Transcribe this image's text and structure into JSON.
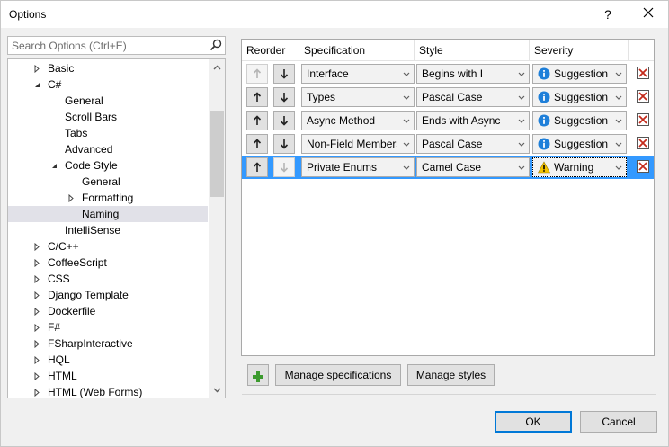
{
  "window": {
    "title": "Options",
    "help_label": "?"
  },
  "search": {
    "placeholder": "Search Options (Ctrl+E)"
  },
  "tree": {
    "items": [
      {
        "label": "Basic",
        "level": 1,
        "arrow": "collapsed"
      },
      {
        "label": "C#",
        "level": 1,
        "arrow": "expanded"
      },
      {
        "label": "General",
        "level": 2,
        "arrow": "none"
      },
      {
        "label": "Scroll Bars",
        "level": 2,
        "arrow": "none"
      },
      {
        "label": "Tabs",
        "level": 2,
        "arrow": "none"
      },
      {
        "label": "Advanced",
        "level": 2,
        "arrow": "none"
      },
      {
        "label": "Code Style",
        "level": 2,
        "arrow": "expanded"
      },
      {
        "label": "General",
        "level": 3,
        "arrow": "none"
      },
      {
        "label": "Formatting",
        "level": 3,
        "arrow": "collapsed"
      },
      {
        "label": "Naming",
        "level": 3,
        "arrow": "none",
        "selected": true
      },
      {
        "label": "IntelliSense",
        "level": 2,
        "arrow": "none"
      },
      {
        "label": "C/C++",
        "level": 1,
        "arrow": "collapsed"
      },
      {
        "label": "CoffeeScript",
        "level": 1,
        "arrow": "collapsed"
      },
      {
        "label": "CSS",
        "level": 1,
        "arrow": "collapsed"
      },
      {
        "label": "Django Template",
        "level": 1,
        "arrow": "collapsed"
      },
      {
        "label": "Dockerfile",
        "level": 1,
        "arrow": "collapsed"
      },
      {
        "label": "F#",
        "level": 1,
        "arrow": "collapsed"
      },
      {
        "label": "FSharpInteractive",
        "level": 1,
        "arrow": "collapsed"
      },
      {
        "label": "HQL",
        "level": 1,
        "arrow": "collapsed"
      },
      {
        "label": "HTML",
        "level": 1,
        "arrow": "collapsed"
      },
      {
        "label": "HTML (Web Forms)",
        "level": 1,
        "arrow": "collapsed"
      }
    ]
  },
  "grid": {
    "headers": {
      "reorder": "Reorder",
      "specification": "Specification",
      "style": "Style",
      "severity": "Severity"
    },
    "rows": [
      {
        "specification": "Interface",
        "style": "Begins with I",
        "severity": "Suggestion",
        "severity_kind": "info",
        "up_disabled": true,
        "down_disabled": false,
        "selected": false
      },
      {
        "specification": "Types",
        "style": "Pascal Case",
        "severity": "Suggestion",
        "severity_kind": "info",
        "up_disabled": false,
        "down_disabled": false,
        "selected": false
      },
      {
        "specification": "Async Method",
        "style": "Ends with Async",
        "severity": "Suggestion",
        "severity_kind": "info",
        "up_disabled": false,
        "down_disabled": false,
        "selected": false
      },
      {
        "specification": "Non-Field Members",
        "style": "Pascal Case",
        "severity": "Suggestion",
        "severity_kind": "info",
        "up_disabled": false,
        "down_disabled": false,
        "selected": false
      },
      {
        "specification": "Private Enums",
        "style": "Camel Case",
        "severity": "Warning",
        "severity_kind": "warning",
        "up_disabled": false,
        "down_disabled": true,
        "selected": true
      }
    ]
  },
  "actions": {
    "manage_specifications": "Manage specifications",
    "manage_styles": "Manage styles"
  },
  "footer": {
    "ok": "OK",
    "cancel": "Cancel"
  },
  "colors": {
    "selection": "#3399ff",
    "tree_selected": "#e1e1e8",
    "primary_border": "#0078d7",
    "add_green": "#3c9a2e",
    "info_blue": "#1e7fd9",
    "warning_yellow": "#f5c400",
    "delete_red": "#c42b1c"
  }
}
